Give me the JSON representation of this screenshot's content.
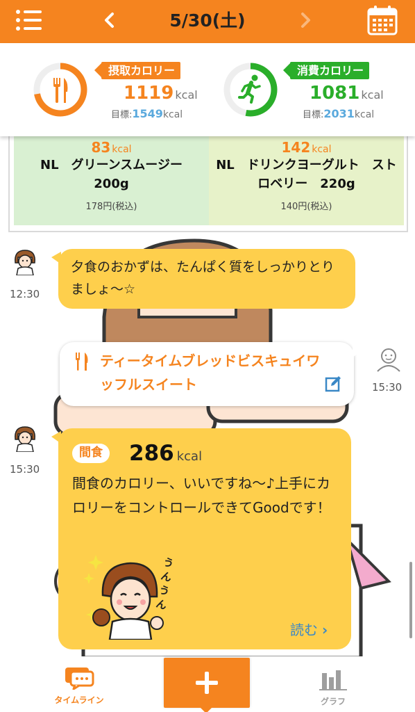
{
  "header": {
    "date": "5/30(土)",
    "menu_icon": "hamburger-menu-icon",
    "prev_icon": "chevron-left-icon",
    "next_icon": "chevron-right-icon",
    "calendar_icon": "calendar-icon"
  },
  "summary": {
    "intake": {
      "label": "摂取カロリー",
      "value": "1119",
      "unit": "kcal",
      "goal_label": "目標:",
      "goal_value": "1549",
      "goal_unit": "kcal",
      "color": "#f5841f",
      "progress": 0.72
    },
    "burn": {
      "label": "消費カロリー",
      "value": "1081",
      "unit": "kcal",
      "goal_label": "目標:",
      "goal_value": "2031",
      "goal_unit": "kcal",
      "color": "#2aae2a",
      "progress": 0.53
    }
  },
  "meals": [
    {
      "kcal": "83",
      "unit": "kcal",
      "name": "NL　グリーンスムージー　200g",
      "price": "178円(税込)"
    },
    {
      "kcal": "142",
      "unit": "kcal",
      "name": "NL　ドリンクヨーグルト　ストロベリー　220g",
      "price": "140円(税込)"
    }
  ],
  "timeline": [
    {
      "type": "advisor",
      "time": "12:30",
      "message": "夕食のおかずは、たんぱく質をしっかりとりましょ〜☆"
    },
    {
      "type": "user",
      "time": "15:30",
      "food": "ティータイムブレッドビスキュイワッフルスイート"
    },
    {
      "type": "advisor",
      "time": "15:30",
      "tag": "間食",
      "kcal": "286",
      "unit": "kcal",
      "message": "間食のカロリー、いいですね〜♪上手にカロリーをコントロールできてGoodです！",
      "read_more": "読む"
    }
  ],
  "bottom_nav": {
    "timeline": "タイムライン",
    "graph": "グラフ",
    "add_icon": "plus-icon"
  },
  "colors": {
    "accent": "#f5841f",
    "green": "#2aae2a",
    "bubble": "#fecf4c",
    "link": "#3a88c6"
  }
}
